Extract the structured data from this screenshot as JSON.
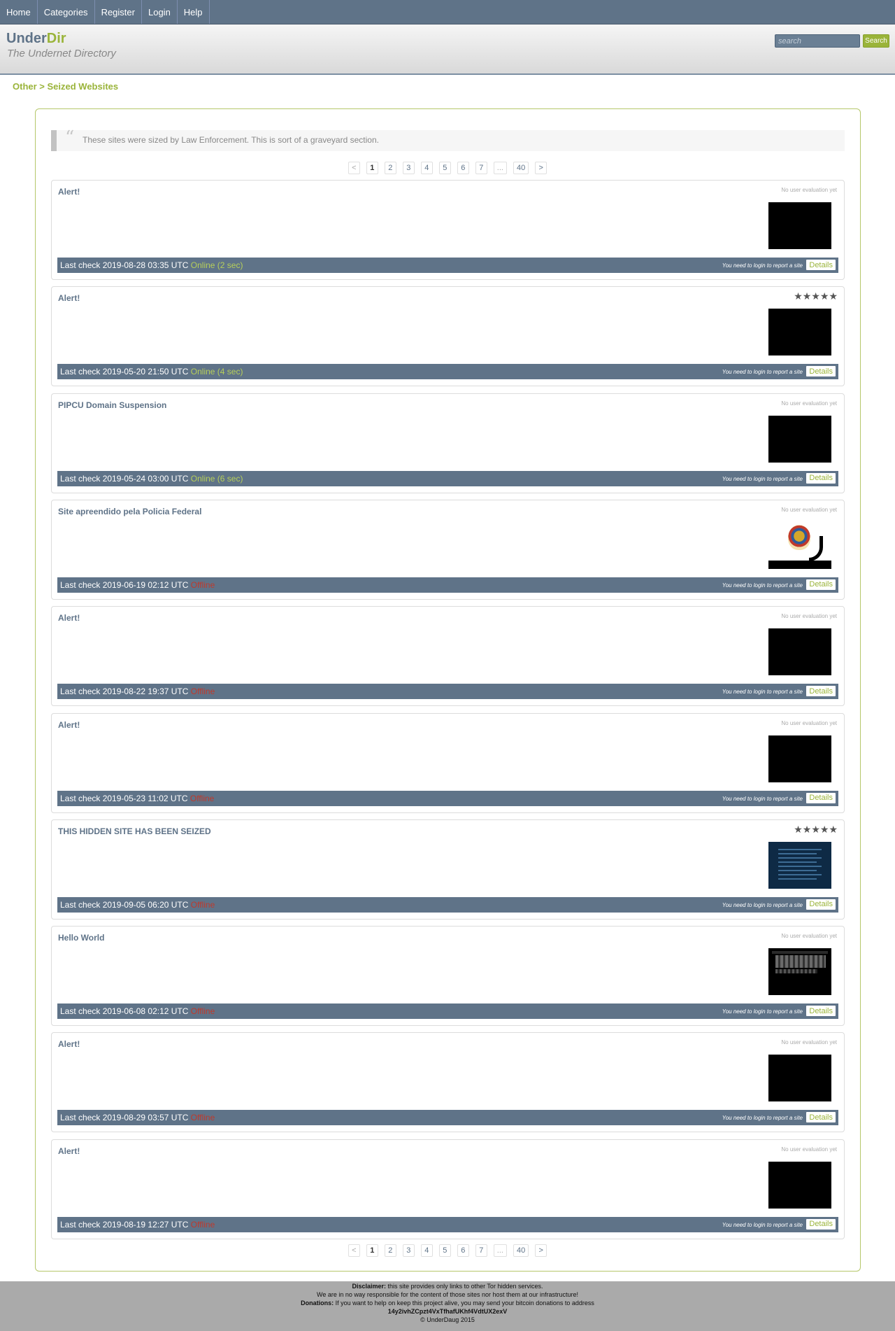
{
  "nav": {
    "items": [
      "Home",
      "Categories",
      "Register",
      "Login",
      "Help"
    ]
  },
  "header": {
    "logo_under": "Under",
    "logo_dir": "Dir",
    "tagline": "The Undernet Directory"
  },
  "search": {
    "placeholder": "search",
    "button_label": "Search"
  },
  "breadcrumb": "Other > Seized Websites",
  "intro_quote": "These sites were sized by Law Enforcement. This is sort of a graveyard section.",
  "pagination": {
    "prev": "<",
    "next": ">",
    "pages": [
      "1",
      "2",
      "3",
      "4",
      "5",
      "6",
      "7",
      "...",
      "40"
    ],
    "current": "1"
  },
  "card_common": {
    "no_rating_text": "No user evaluation yet",
    "stars": "★★★★★",
    "login_note": "You need to login to report a site",
    "details_label": "Details"
  },
  "sites": [
    {
      "title": "Alert!",
      "rated": false,
      "last_check": "Last check 2019-08-28 03:35 UTC",
      "status": "Online (2 sec)",
      "online": true,
      "thumb": "black"
    },
    {
      "title": "Alert!",
      "rated": true,
      "last_check": "Last check 2019-05-20 21:50 UTC",
      "status": "Online (4 sec)",
      "online": true,
      "thumb": "black"
    },
    {
      "title": "PIPCU Domain Suspension",
      "rated": false,
      "last_check": "Last check 2019-05-24 03:00 UTC",
      "status": "Online (6 sec)",
      "online": true,
      "thumb": "black"
    },
    {
      "title": "Site apreendido pela Policia Federal",
      "rated": false,
      "last_check": "Last check 2019-06-19 02:12 UTC",
      "status": "Offline",
      "online": false,
      "thumb": "seal"
    },
    {
      "title": "Alert!",
      "rated": false,
      "last_check": "Last check 2019-08-22 19:37 UTC",
      "status": "Offline",
      "online": false,
      "thumb": "black"
    },
    {
      "title": "Alert!",
      "rated": false,
      "last_check": "Last check 2019-05-23 11:02 UTC",
      "status": "Offline",
      "online": false,
      "thumb": "black"
    },
    {
      "title": "THIS HIDDEN SITE HAS BEEN SEIZED",
      "rated": true,
      "last_check": "Last check 2019-09-05 06:20 UTC",
      "status": "Offline",
      "online": false,
      "thumb": "seized"
    },
    {
      "title": "Hello World",
      "rated": false,
      "last_check": "Last check 2019-06-08 02:12 UTC",
      "status": "Offline",
      "online": false,
      "thumb": "hello"
    },
    {
      "title": "Alert!",
      "rated": false,
      "last_check": "Last check 2019-08-29 03:57 UTC",
      "status": "Offline",
      "online": false,
      "thumb": "black"
    },
    {
      "title": "Alert!",
      "rated": false,
      "last_check": "Last check 2019-08-19 12:27 UTC",
      "status": "Offline",
      "online": false,
      "thumb": "black"
    }
  ],
  "footer": {
    "disclaimer_label": "Disclaimer:",
    "disclaimer_text": " this site provides only links to other Tor hidden services.",
    "responsibility": "We are in no way responsible for the content of those sites nor host them at our infrastructure!",
    "donations_label": "Donations:",
    "donations_text": " If you want to help on keep this project alive, you may send your bitcoin donations to address",
    "btc_address": "14y2ivhZCpzt4VxTfhafUKhf4VdtUX2exV",
    "copyright": "© UnderDaug 2015"
  },
  "colors": {
    "nav_bg": "#5f7388",
    "accent_green": "#9ab43a",
    "offline_red": "#c0392b"
  }
}
